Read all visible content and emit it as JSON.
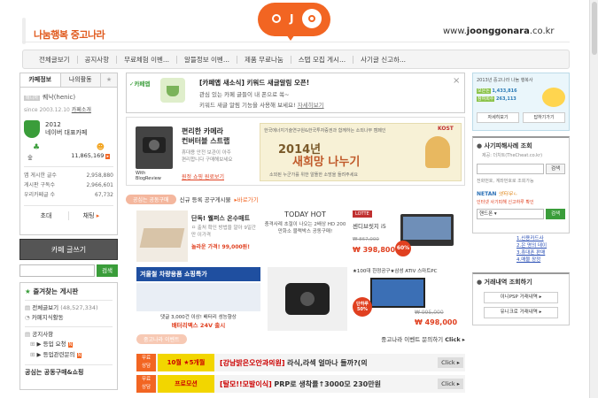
{
  "header": {
    "tagline": "나눔행복 중고나라",
    "url_prefix": "www.",
    "url_bold": "joonggonara",
    "url_suffix": ".co.kr"
  },
  "nav": {
    "items": [
      "전체글보기",
      "공지사항",
      "무료체험 이벤...",
      "알뜰정보 이벤...",
      "제품 무료나눔",
      "스탭 모집 게시...",
      "사기글 신고하..."
    ]
  },
  "left": {
    "tabs": {
      "cafe_info": "카페정보",
      "my_activity": "나의활동"
    },
    "manager_name": "퀘낙(henic)",
    "since": "since 2003.12.10",
    "cafe_intro": "카페소개",
    "award_year": "2012",
    "award_label": "네이버 대표카페",
    "members_count": "11,865,169",
    "stats": [
      {
        "label": "앱 게시한 글수",
        "value": "2,958,880"
      },
      {
        "label": "게시판 구독수",
        "value": "2,966,601"
      },
      {
        "label": "우리카페글 수",
        "value": "67,732"
      }
    ],
    "invite_label": "초대",
    "chat_label": "채팅",
    "write_label": "카페 글쓰기",
    "search_button": "검색",
    "favorites_title": "즐겨찾는 게시판",
    "board_all": "전체글보기",
    "board_all_count": "(48,527,334)",
    "board_popular": "카페지식활동",
    "notice_link": "공지사항",
    "sub1": "등업 요청",
    "sub2": "등업관련문의",
    "bottom_title": "공심는 공동구매&쇼핑"
  },
  "notice": {
    "tag": "카페앱",
    "title": "[카페앱 새소식] 키워드 새글알림 오픈!",
    "line1": "관심 있는 카페 글들이 내 폰으로 쏙~",
    "line2": "키워드 새글 알림 기능을 사용해 보세요!",
    "detail": "자세히보기"
  },
  "ad1": {
    "title1": "편리한 카메라",
    "title2": "컨버터블 스트랩",
    "desc": "휴대용 안전 보관이 아주 편리합니다 구매해보세요",
    "brand": "With",
    "brand2": "BlogReview",
    "cta": "원정 쇼핑 원료보기",
    "banner_top": "한국에너지기술연구원&한국투자증권과 함께하는 소외나무 캠페인",
    "banner_kost": "KOST",
    "banner_main1": "2014년",
    "banner_main2": "새희망 나누기",
    "banner_sub": "소외된 누군가를 위한 알뜰한 소망을 들려주세요"
  },
  "sec1": {
    "header_pill": "공심는 공동구매",
    "header_text": "신규 등록 공구게시물",
    "header_more": "바로가기",
    "p1_title": "단독! 웰퍼스 온수매트",
    "p1_desc": "ㅁ 출처 확인 방법을 알아 9일간만 이가격",
    "p1_price": "놀라운 가격! 99,000원!",
    "p2_title": "TODAY HOT",
    "p2_desc": "충격사례 초절이 나오는 2배상 HD 200만화소 블랙박스 공동구매!",
    "p3_brand": "LOTTE",
    "p3_title": "센디브릿지 i5",
    "p3_old": "₩ 867,000",
    "p3_price": "₩ 398,800",
    "p3_badge": "60%",
    "p4_title": "겨울철 차량용품 쇼핑특가",
    "p4_desc": "댓글 3,000건 이상! 배터리 성능향상",
    "p4_sub": "배터리맥스 24V 출시",
    "p6_title": "★100대 한정공구★삼성 ATIV 스마트PC",
    "p6_badge": "단하루 50%",
    "p6_old": "₩ 995,000",
    "p6_price": "₩ 498,000"
  },
  "sec2": {
    "header_pill": "중고나라 이벤트",
    "header_right": "중고나라 이벤트 문의하기",
    "header_click": "Click",
    "row1_badge1": "무료",
    "row1_badge2": "상담",
    "row1_ad": "10월 ★5개월",
    "row1_text_red": "[강남밝은오안과의원]",
    "row1_text": "라식,라섹 얼마나 들까?(의",
    "row1_click": "Click",
    "row2_badge1": "무료",
    "row2_badge2": "상담",
    "row2_ad": "프로모션",
    "row2_text_red": "[탈모!!모발이식]",
    "row2_text": "PRP로 생착률↑3000모 230만원",
    "row2_click": "Click"
  },
  "right": {
    "event_text": "2013년 중고나라 나눔 행복사",
    "label1": "모은돈",
    "value1": "1,433,816",
    "label2": "참여회수",
    "value2": "263,113",
    "btn1": "자세히보기",
    "btn2": "답하기가기",
    "fraud_title": "사기피해사례 조회",
    "fraud_sub": "제공: 더치트(TheCheat.co.kr)",
    "fraud_btn": "검색",
    "fraud_desc": "전화번호, 계좌번호로 조회가능",
    "netan1": "NETAN",
    "netan2": "넷타우ㄴ",
    "netan_sub": "인터넷 사기피해 신고하루 확인",
    "select_value": "핸드폰",
    "search_btn": "검색",
    "links": [
      "1.신용카드사",
      "2.은 명의 데이",
      "3.휴대폰 판매",
      "4.매물 장정"
    ],
    "trade_title": "거래내역 조회하기",
    "trade1": "이니PSP 거래내역",
    "trade2": "유니크로 거래내역",
    "url_highlight": "#f26522",
    "green": "#2e8b2e"
  }
}
